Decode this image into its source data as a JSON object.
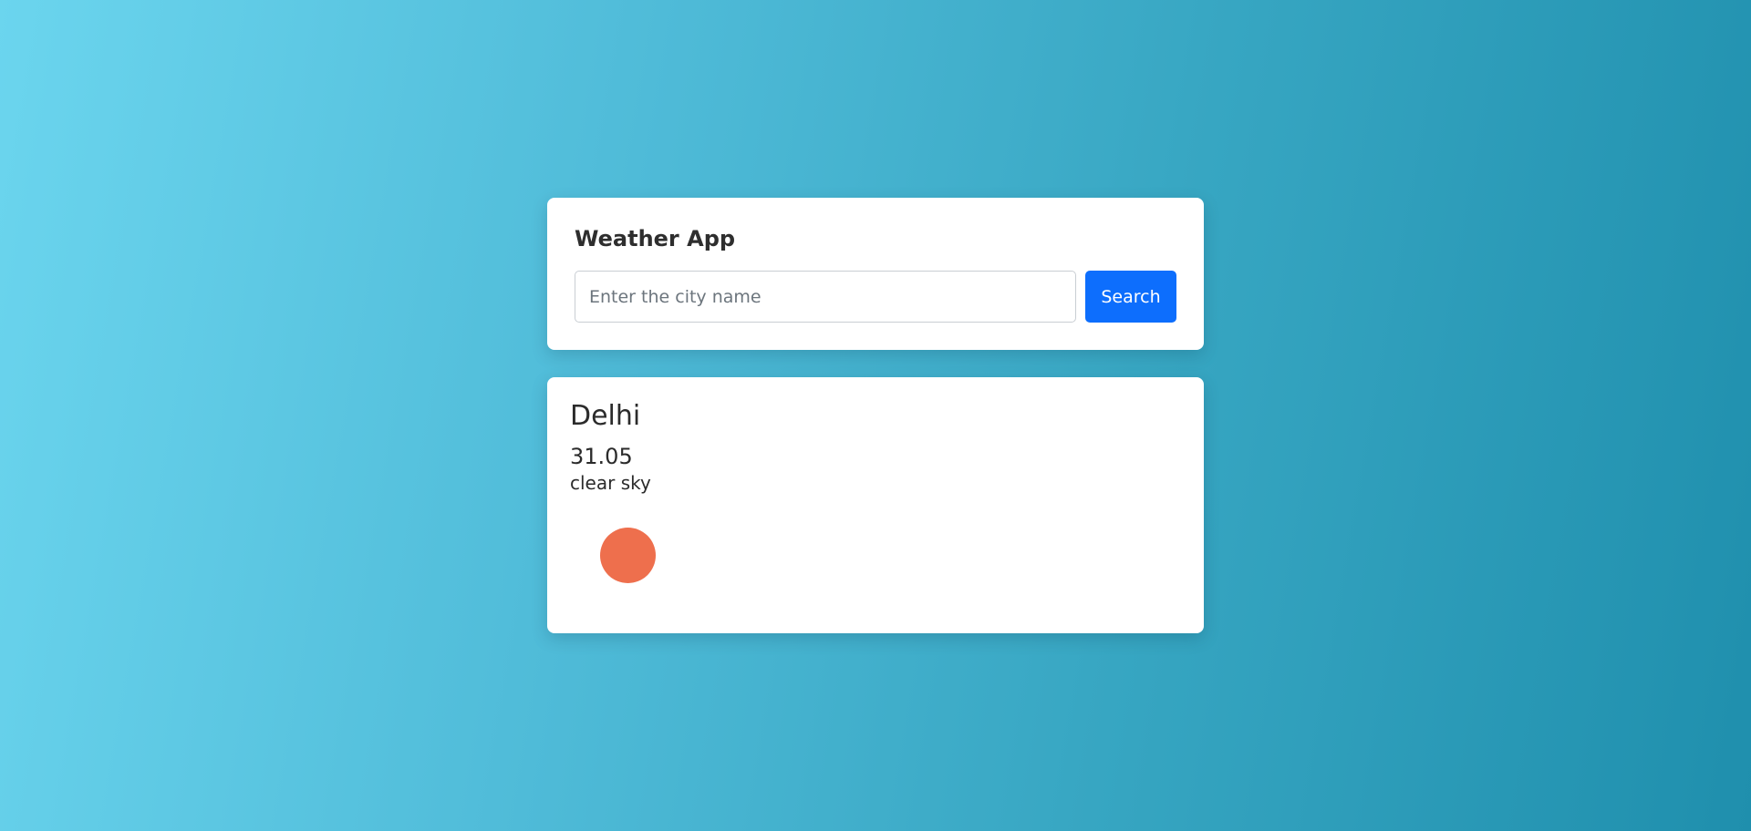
{
  "app": {
    "title": "Weather App"
  },
  "search": {
    "placeholder": "Enter the city name",
    "value": "",
    "button_label": "Search"
  },
  "weather": {
    "city": "Delhi",
    "temperature": "31.05",
    "description": "clear sky",
    "icon": "sun-icon",
    "icon_color": "#ee6f4d"
  },
  "colors": {
    "accent": "#0d6efd",
    "background_start": "#6bd5ee",
    "background_end": "#1f8fad"
  }
}
